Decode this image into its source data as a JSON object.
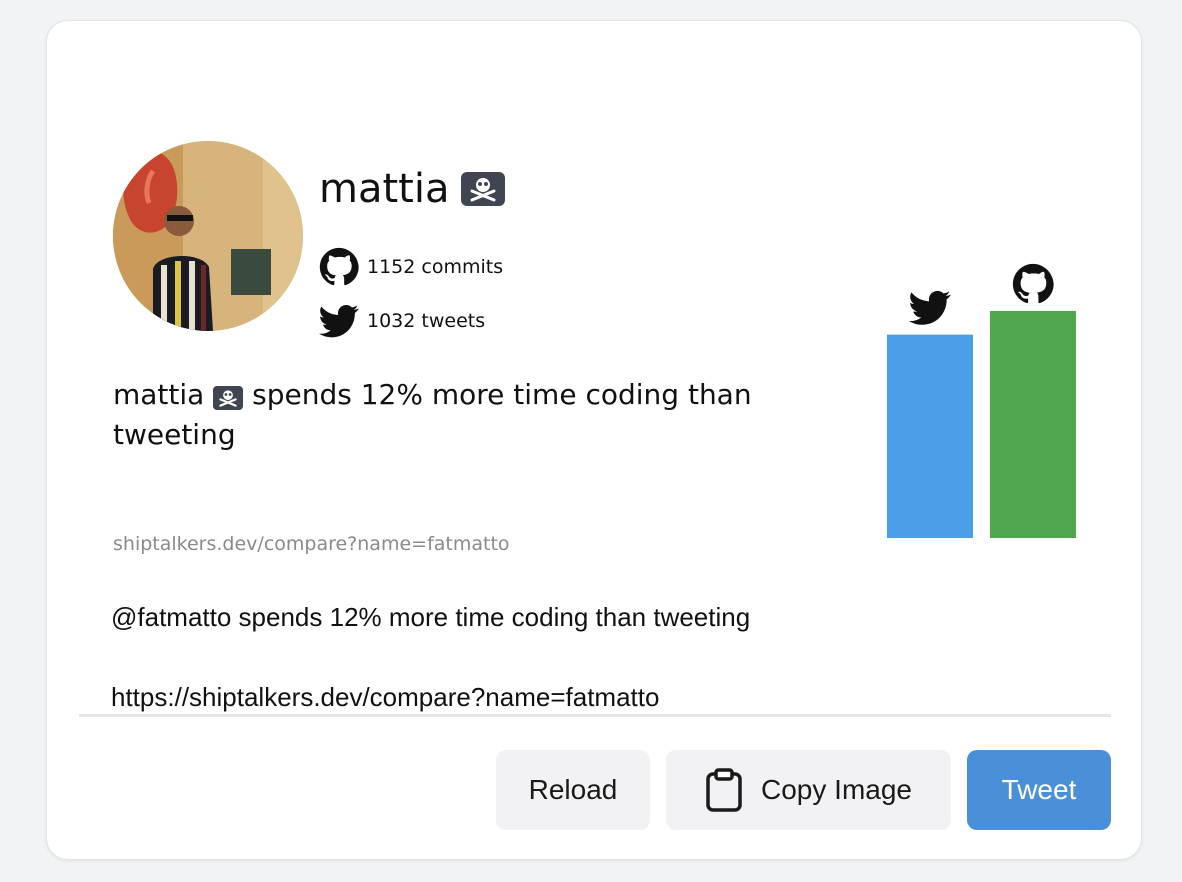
{
  "profile": {
    "username": "mattia",
    "badge_icon": "skull-crossbones-icon",
    "avatar_alt": "profile photo"
  },
  "stats": {
    "commits": "1152 commits",
    "tweets": "1032 tweets"
  },
  "summary": {
    "name": "mattia",
    "text": "spends 12% more time coding than tweeting"
  },
  "share_url": "shiptalkers.dev/compare?name=fatmatto",
  "chart_data": {
    "type": "bar",
    "categories": [
      "twitter",
      "github"
    ],
    "values": [
      1032,
      1152
    ],
    "colors": [
      "#4c9ee8",
      "#4fa64f"
    ],
    "icons": [
      "twitter-icon",
      "github-icon"
    ]
  },
  "tweet": {
    "line1": "@fatmatto spends 12% more time coding than tweeting",
    "line2": "https://shiptalkers.dev/compare?name=fatmatto"
  },
  "buttons": {
    "reload": "Reload",
    "copy_image": "Copy Image",
    "tweet": "Tweet"
  },
  "colors": {
    "accent": "#4a90d9",
    "twitter_bar": "#4c9ee8",
    "github_bar": "#4fa64f"
  }
}
